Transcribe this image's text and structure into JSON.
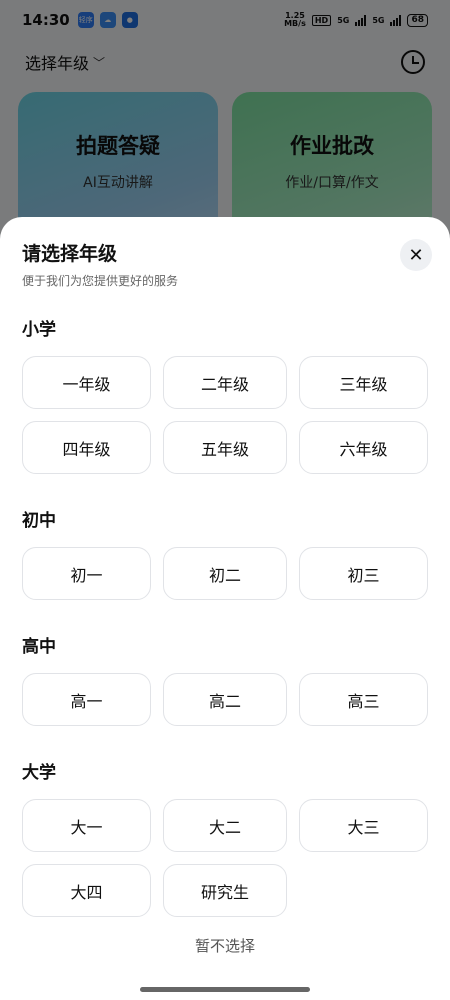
{
  "status": {
    "time": "14:30",
    "app_badge": "轻序",
    "speed_value": "1.25",
    "speed_unit": "MB/s",
    "hd": "HD",
    "network1": "5G",
    "network2": "5G",
    "battery": "68"
  },
  "top_bar": {
    "grade_select_label": "选择年级",
    "chevron": "﹀"
  },
  "cards": [
    {
      "title": "拍题答疑",
      "subtitle": "AI互动讲解"
    },
    {
      "title": "作业批改",
      "subtitle": "作业/口算/作文"
    }
  ],
  "sheet": {
    "title": "请选择年级",
    "subtitle": "便于我们为您提供更好的服务",
    "close": "✕",
    "sections": [
      {
        "title": "小学",
        "items": [
          "一年级",
          "二年级",
          "三年级",
          "四年级",
          "五年级",
          "六年级"
        ]
      },
      {
        "title": "初中",
        "items": [
          "初一",
          "初二",
          "初三"
        ]
      },
      {
        "title": "高中",
        "items": [
          "高一",
          "高二",
          "高三"
        ]
      },
      {
        "title": "大学",
        "items": [
          "大一",
          "大二",
          "大三",
          "大四",
          "研究生"
        ]
      }
    ],
    "skip_label": "暂不选择"
  },
  "colors": {
    "overlay": "#000000",
    "sheet_bg": "#ffffff",
    "button_border": "#e1e3e7"
  }
}
